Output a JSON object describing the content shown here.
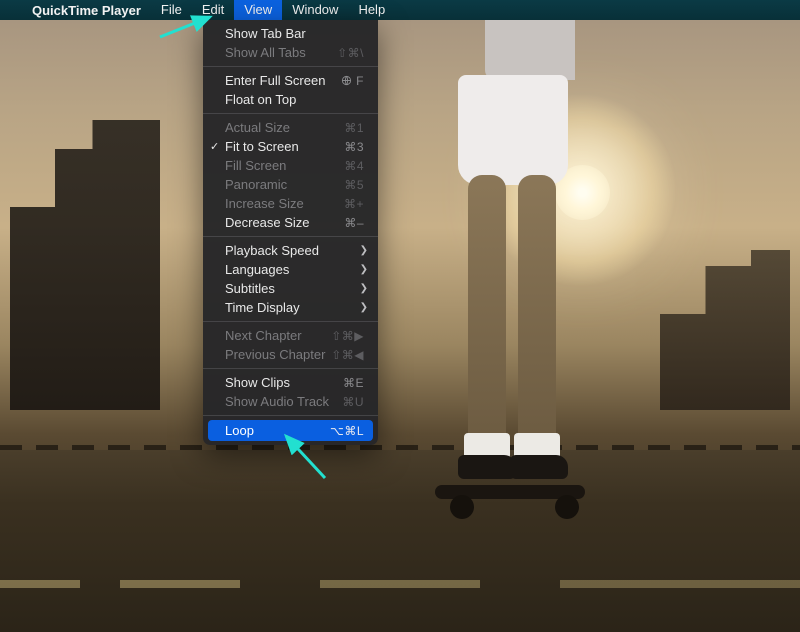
{
  "menubar": {
    "apple_icon": "apple-logo",
    "app_name": "QuickTime Player",
    "items": [
      "File",
      "Edit",
      "View",
      "Window",
      "Help"
    ],
    "active_index": 2
  },
  "view_menu": {
    "groups": [
      [
        {
          "label": "Show Tab Bar",
          "shortcut": "",
          "enabled": true
        },
        {
          "label": "Show All Tabs",
          "shortcut": "⇧⌘\\",
          "enabled": false
        }
      ],
      [
        {
          "label": "Enter Full Screen",
          "shortcut": "㆞F",
          "enabled": true,
          "shortcut_icon": "globe"
        },
        {
          "label": "Float on Top",
          "shortcut": "",
          "enabled": true
        }
      ],
      [
        {
          "label": "Actual Size",
          "shortcut": "⌘1",
          "enabled": false
        },
        {
          "label": "Fit to Screen",
          "shortcut": "⌘3",
          "enabled": true,
          "checked": true
        },
        {
          "label": "Fill Screen",
          "shortcut": "⌘4",
          "enabled": false
        },
        {
          "label": "Panoramic",
          "shortcut": "⌘5",
          "enabled": false
        },
        {
          "label": "Increase Size",
          "shortcut": "⌘+",
          "enabled": false
        },
        {
          "label": "Decrease Size",
          "shortcut": "⌘–",
          "enabled": true
        }
      ],
      [
        {
          "label": "Playback Speed",
          "submenu": true,
          "enabled": true
        },
        {
          "label": "Languages",
          "submenu": true,
          "enabled": true
        },
        {
          "label": "Subtitles",
          "submenu": true,
          "enabled": true
        },
        {
          "label": "Time Display",
          "submenu": true,
          "enabled": true
        }
      ],
      [
        {
          "label": "Next Chapter",
          "shortcut": "⇧⌘▶",
          "enabled": false
        },
        {
          "label": "Previous Chapter",
          "shortcut": "⇧⌘◀",
          "enabled": false
        }
      ],
      [
        {
          "label": "Show Clips",
          "shortcut": "⌘E",
          "enabled": true
        },
        {
          "label": "Show Audio Track",
          "shortcut": "⌘U",
          "enabled": false
        }
      ],
      [
        {
          "label": "Loop",
          "shortcut": "⌥⌘L",
          "enabled": true,
          "highlighted": true
        }
      ]
    ]
  },
  "annotations": {
    "arrow_color": "#22e0d0",
    "arrow1_target": "View menu",
    "arrow2_target": "Loop item"
  }
}
